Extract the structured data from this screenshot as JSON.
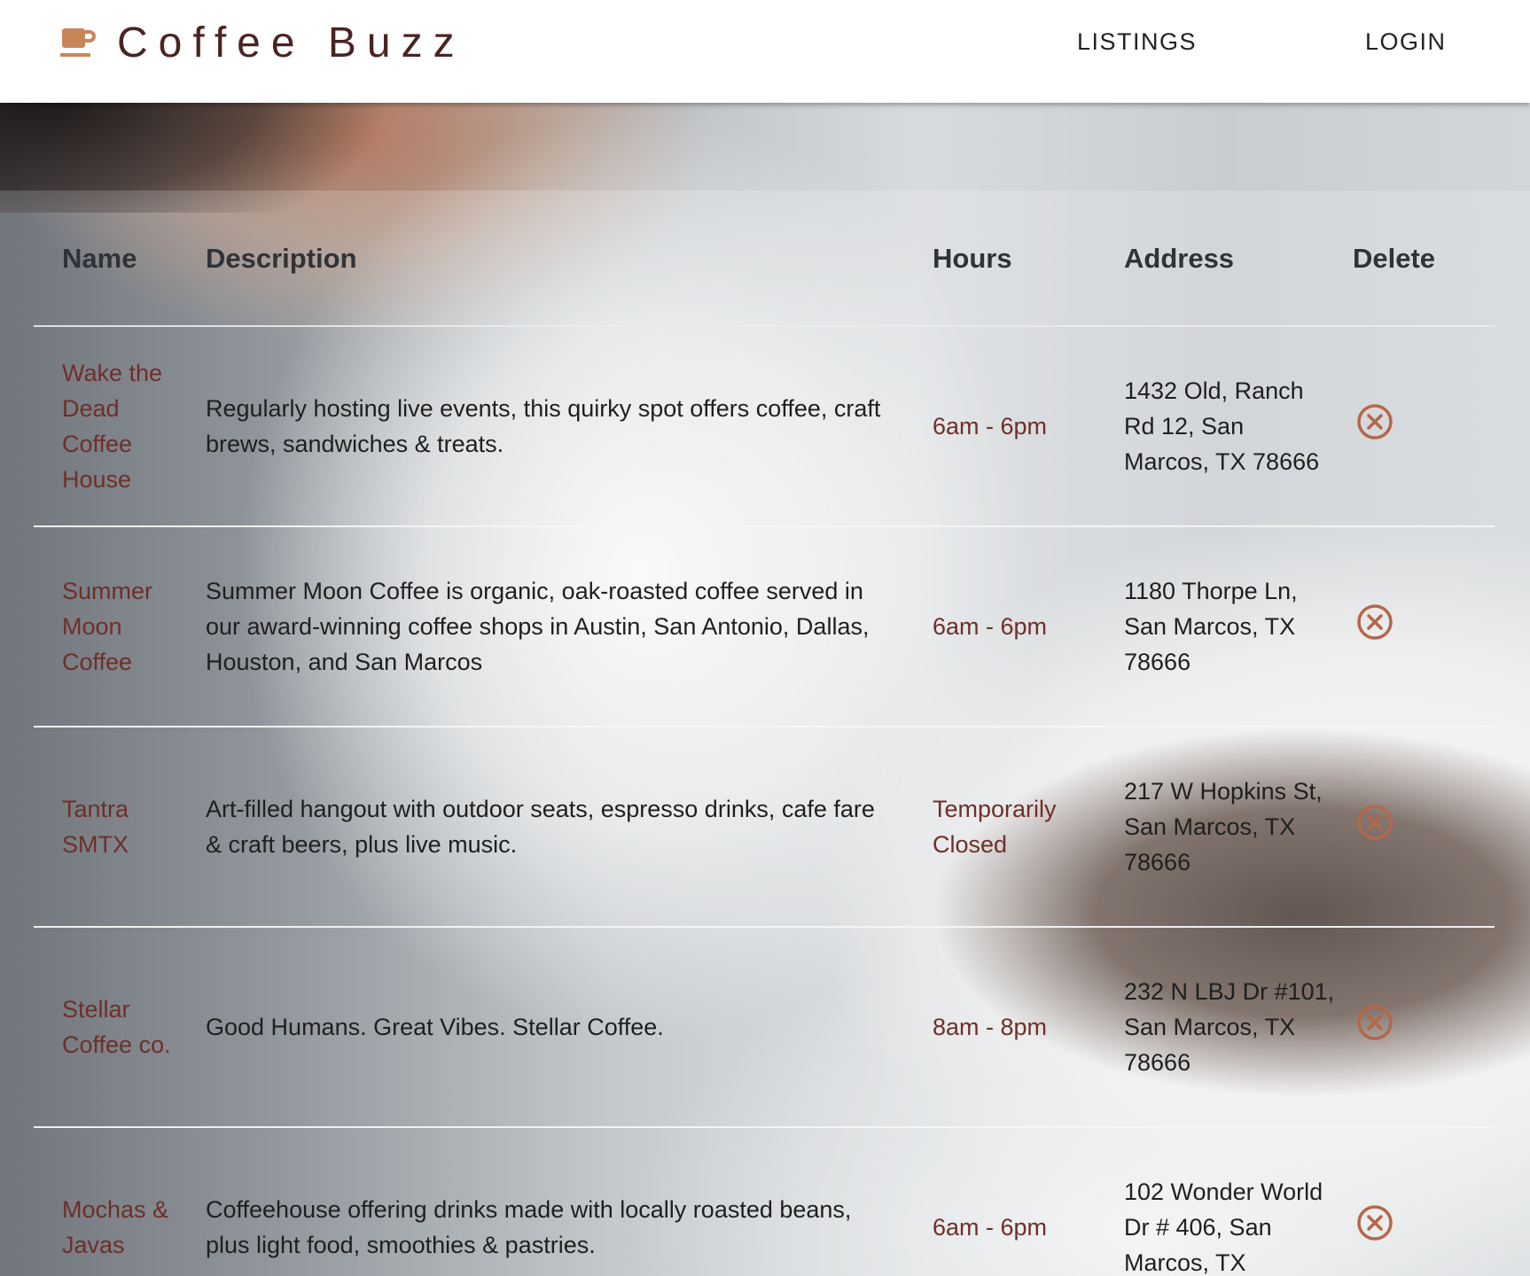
{
  "header": {
    "brand": "Coffee Buzz",
    "nav": {
      "listings": "LISTINGS",
      "login": "LOGIN"
    }
  },
  "table": {
    "columns": {
      "name": "Name",
      "description": "Description",
      "hours": "Hours",
      "address": "Address",
      "delete": "Delete"
    },
    "rows": [
      {
        "name": "Wake the Dead Coffee House",
        "description": "Regularly hosting live events, this quirky spot offers coffee, craft brews, sandwiches & treats.",
        "hours": "6am - 6pm",
        "address": "1432 Old, Ranch Rd 12, San Marcos, TX 78666"
      },
      {
        "name": "Summer Moon Coffee",
        "description": "Summer Moon Coffee is organic, oak-roasted coffee served in our award-winning coffee shops in Austin, San Antonio, Dallas, Houston, and San Marcos",
        "hours": "6am - 6pm",
        "address": "1180 Thorpe Ln, San Marcos, TX 78666"
      },
      {
        "name": "Tantra SMTX",
        "description": "Art-filled hangout with outdoor seats, espresso drinks, cafe fare & craft beers, plus live music.",
        "hours": "Temporarily Closed",
        "address": "217 W Hopkins St, San Marcos, TX 78666"
      },
      {
        "name": "Stellar Coffee co.",
        "description": "Good Humans. Great Vibes. Stellar Coffee.",
        "hours": "8am - 8pm",
        "address": "232 N LBJ Dr #101, San Marcos, TX 78666"
      },
      {
        "name": "Mochas & Javas",
        "description": "Coffeehouse offering drinks made with locally roasted beans, plus light food, smoothies & pastries.",
        "hours": "6am - 6pm",
        "address": "102 Wonder World Dr # 406, San Marcos, TX"
      }
    ]
  },
  "colors": {
    "brand": "#4b2322",
    "accent": "#b4674a",
    "name_text": "#6e2f28"
  },
  "icons": {
    "brand": "coffee-cup-icon",
    "delete": "circle-x-icon"
  }
}
